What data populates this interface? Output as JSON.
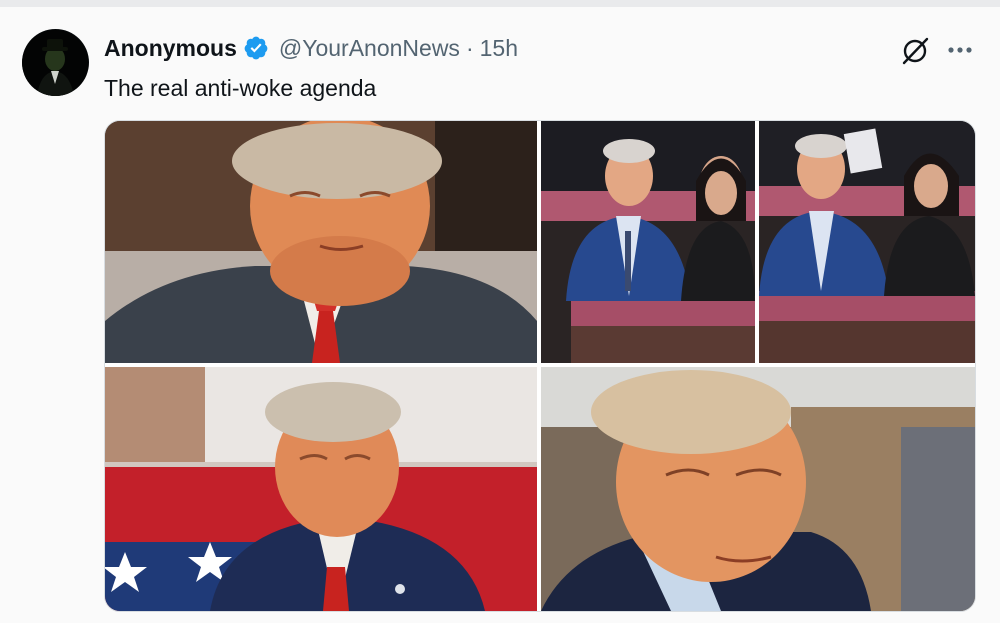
{
  "tweet": {
    "author_name": "Anonymous",
    "handle": "@YourAnonNews",
    "separator": "·",
    "time": "15h",
    "text": "The real anti-woke agenda"
  },
  "icons": {
    "verified": "verified-badge-icon",
    "grok": "grok-icon",
    "more": "more-options-icon"
  },
  "colors": {
    "verified": "#1d9bf0",
    "text_primary": "#0f1419",
    "text_secondary": "#536471"
  },
  "media": {
    "count": 5
  }
}
